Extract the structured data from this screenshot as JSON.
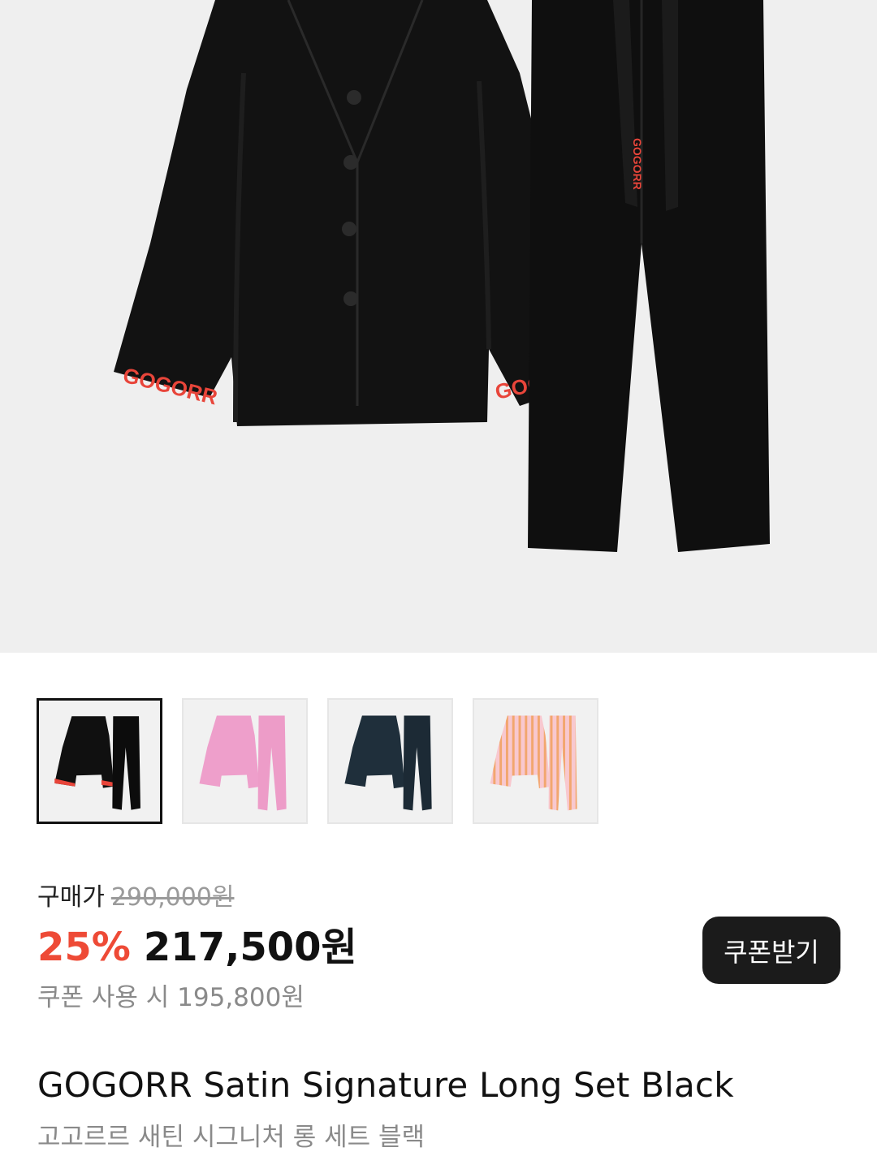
{
  "gallery": {
    "thumbnails": [
      {
        "label": "Black",
        "color": "#101010",
        "accent": "#e8453a",
        "selected": true
      },
      {
        "label": "Pink",
        "color": "#ee9fcb",
        "accent": "#ee9fcb",
        "selected": false
      },
      {
        "label": "Navy",
        "color": "#1f2f3b",
        "accent": "#1f2f3b",
        "selected": false
      },
      {
        "label": "Stripe",
        "color": "#f6b9c4",
        "accent": "#f2a66e",
        "selected": false
      }
    ],
    "hero_print_text": "GOGORR"
  },
  "price": {
    "label": "구매가",
    "original": "290,000원",
    "discount": "25%",
    "sale": "217,500원",
    "coupon_price": "쿠폰 사용 시 195,800원"
  },
  "coupon_button": {
    "label": "쿠폰받기"
  },
  "product": {
    "title_en": "GOGORR Satin Signature Long Set Black",
    "title_ko": "고고르르 새틴 시그니처 롱 세트 블랙"
  }
}
